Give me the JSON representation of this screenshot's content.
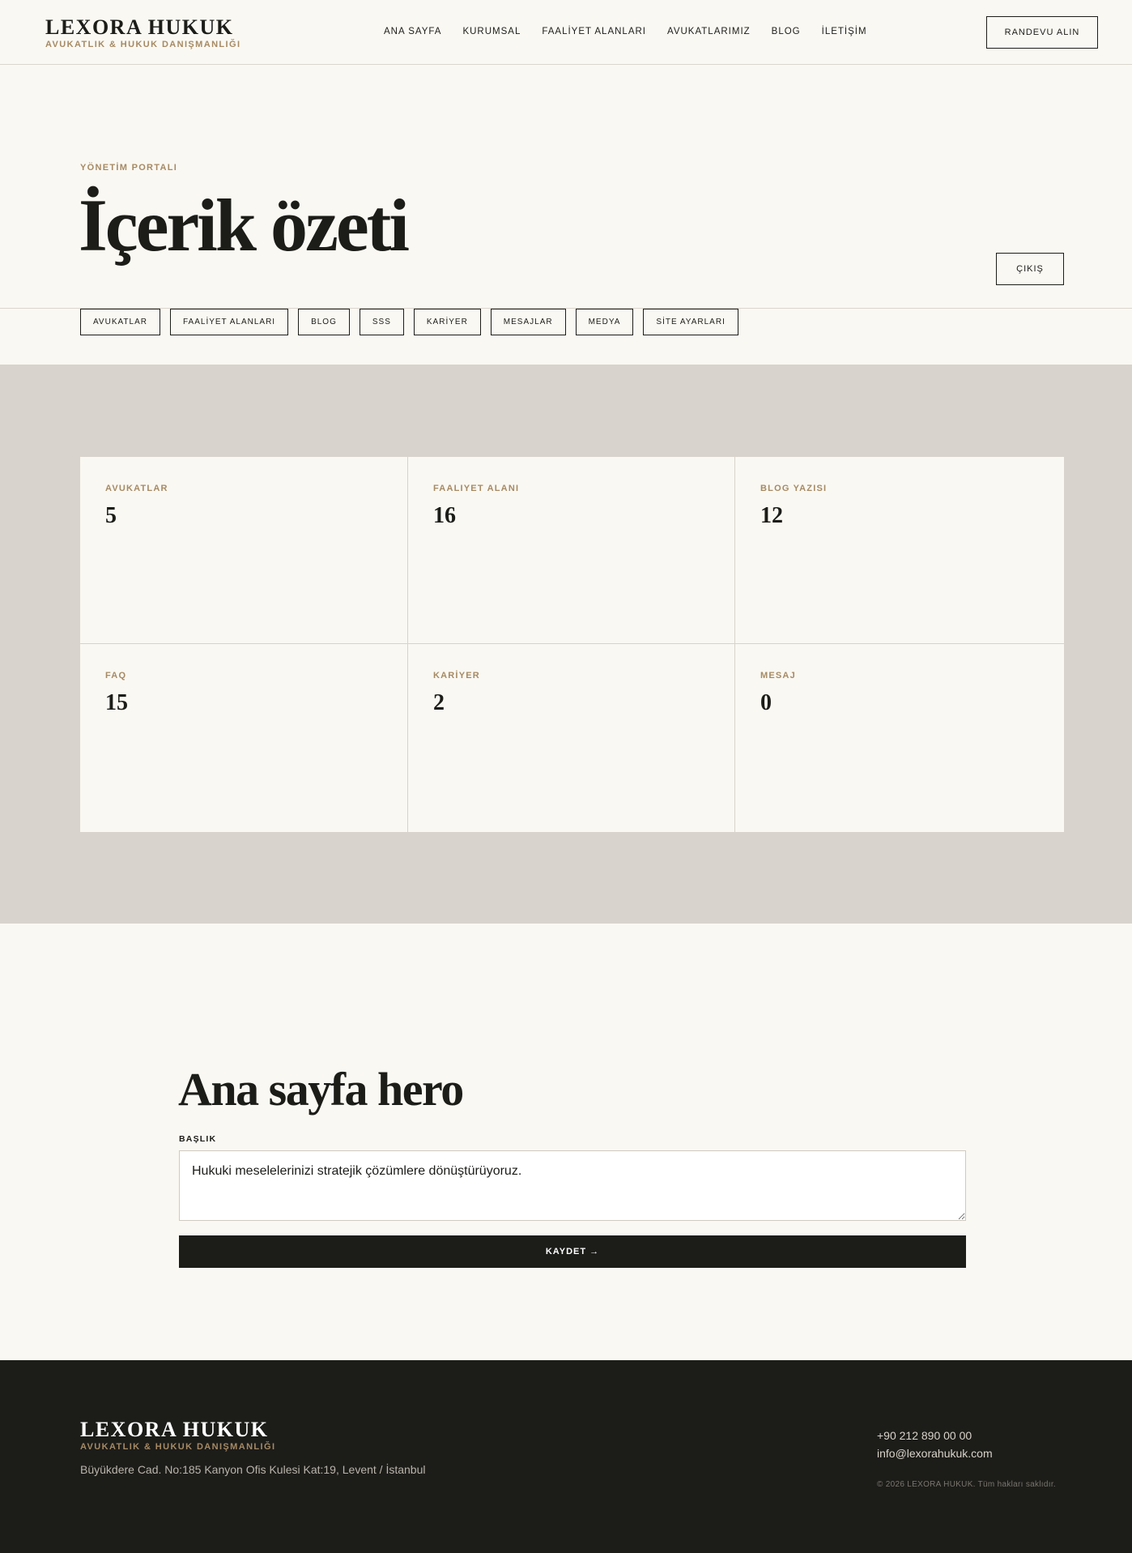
{
  "header": {
    "brand_name": "LEXORA HUKUK",
    "brand_sub": "AVUKATLIK & HUKUK DANIŞMANLIĞI",
    "nav": [
      "ANA SAYFA",
      "KURUMSAL",
      "FAALİYET ALANLARI",
      "AVUKATLARIMIZ",
      "BLOG",
      "İLETİŞİM"
    ],
    "cta_label": "RANDEVU ALIN"
  },
  "portal": {
    "eyebrow": "YÖNETİM PORTALI",
    "title": "İçerik özeti",
    "logout_label": "ÇIKIŞ",
    "tabs": [
      "AVUKATLAR",
      "FAALİYET ALANLARI",
      "BLOG",
      "SSS",
      "KARİYER",
      "MESAJLAR",
      "MEDYA",
      "SİTE AYARLARI"
    ]
  },
  "stats": [
    {
      "label": "AVUKATLAR",
      "value": "5"
    },
    {
      "label": "FAALIYET ALANI",
      "value": "16"
    },
    {
      "label": "BLOG YAZISI",
      "value": "12"
    },
    {
      "label": "FAQ",
      "value": "15"
    },
    {
      "label": "KARİYER",
      "value": "2"
    },
    {
      "label": "MESAJ",
      "value": "0"
    }
  ],
  "hero_form": {
    "title": "Ana sayfa hero",
    "field_label": "BAŞLIK",
    "field_value": "Hukuki meselelerinizi stratejik çözümlere dönüştürüyoruz.",
    "save_label": "KAYDET →"
  },
  "footer": {
    "brand_name": "LEXORA HUKUK",
    "brand_sub": "AVUKATLIK & HUKUK DANIŞMANLIĞI",
    "address": "Büyükdere Cad. No:185 Kanyon Ofis Kulesi Kat:19, Levent / İstanbul",
    "phone": "+90 212 890 00 00",
    "email": "info@lexorahukuk.com",
    "copyright": "© 2026 LEXORA HUKUK. Tüm hakları saklıdır."
  },
  "colors": {
    "background": "#faf8f2",
    "ink": "#1c1c19",
    "accent": "#a68a64",
    "band": "#d8d3cc"
  }
}
